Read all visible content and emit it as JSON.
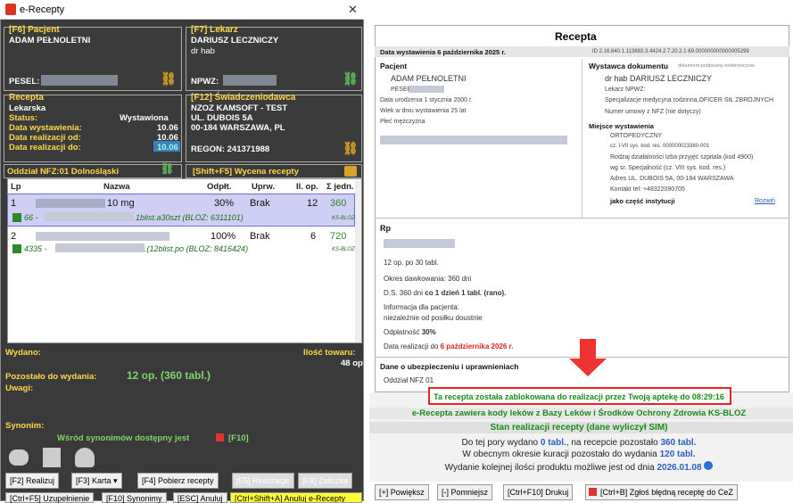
{
  "window": {
    "title": "e-Recepty",
    "close": "✕"
  },
  "patient": {
    "header": "[F6] Pacjent",
    "name": "ADAM PEŁNOLETNI",
    "pesel_label": "PESEL:"
  },
  "doctor": {
    "header": "[F7] Lekarz",
    "name": "DARIUSZ LECZNICZY",
    "title": "dr hab",
    "npwz_label": "NPWZ:"
  },
  "rx": {
    "header": "Recepta",
    "type": "Lekarska",
    "status_label": "Status:",
    "status_value": "Wystawiona",
    "issued_label": "Data wystawienia:",
    "issued_value": "10.06",
    "from_label": "Data realizacji od:",
    "from_value": "10.06",
    "to_label": "Data realizacji do:",
    "to_value": "10.06"
  },
  "provider": {
    "header": "[F12] Świadczeniodawca",
    "name": "NZOZ KAMSOFT - TEST",
    "street": "UL. DUBOIS 5A",
    "city": "00-184 WARSZAWA, PL",
    "regon": "REGON: 241371988"
  },
  "nfz": {
    "label": "Oddział NFZ:01 Dolnośląski",
    "valuation": "[Shift+F5] Wycena recepty"
  },
  "table": {
    "headers": [
      "Lp",
      "Nazwa",
      "Odpłt.",
      "Uprw.",
      "Il. op.",
      "Σ jedn."
    ],
    "rows": [
      {
        "lp": "1",
        "name_end": "10 mg",
        "pay": "30%",
        "perm": "Brak",
        "qty": "12",
        "units": "360",
        "code": "66 -",
        "pack": "1blist.a30szt (BLOZ: 6311101)",
        "tag": "KS-BLOZ"
      },
      {
        "lp": "2",
        "name_end": "",
        "pay": "100%",
        "perm": "Brak",
        "qty": "6",
        "units": "720",
        "code": "4335 -",
        "pack": ".(12blist.po (BLOZ: 8416424)",
        "tag": "KS-BLOZ"
      }
    ]
  },
  "dispense": {
    "issued_label": "Wydano:",
    "qty_label": "Ilość towaru:",
    "qty_value": "48 op",
    "remaining_label": "Pozostało do wydania:",
    "remaining_value": "12 op. (360 tabl.)",
    "notes_label": "Uwagi:",
    "synonym_label": "Synonim:",
    "synonym_text": "Wśród synonimów dostępny jest",
    "synonym_key": "[F10]"
  },
  "buttons": {
    "realize": "[F2] Realizuj",
    "card": "[F3] Karta ▾",
    "fetch": "[F4] Pobierz recepty",
    "f5": "[F5] Realizacje",
    "f8": "[F8] Zaliczka",
    "row2a": "[Ctrl+F5] Uzupełnienie",
    "row2b": "[F10] Synonimy",
    "row2c": "[ESC] Anuluj",
    "row2d": "[Ctrl+Shift+A] Anuluj e-Recepty"
  },
  "doc": {
    "title": "Recepta",
    "issued": "Data wystawienia 6 października 2025 r.",
    "id": "ID 2.16.840.1.113883.3.4424.2.7.20.2.1 69.000000000000005299",
    "patient_h": "Pacjent",
    "patient_name": "ADAM PEŁNOLETNI",
    "pesel": "PESEL",
    "dob": "Data urodzenia 1 stycznia 2000 r.",
    "age": "Wiek w dniu wystawienia 25 lat",
    "sex": "Płeć mężczyzna",
    "issuer_h": "Wystawca dokumentu",
    "issuer_note": "dokument podpisany elektronicznie",
    "issuer_name": "dr hab DARIUSZ LECZNICZY",
    "npwz": "Lekarz NPWZ:",
    "spec": "Specjalizacje medycyna rodzinna,OFICER SIŁ ZBROJNYCH",
    "contract": "Numer umowy z NFZ (nie dotyczy)",
    "place_h": "Miejsce wystawienia",
    "place1": "ORTOPEDYCZNY",
    "place2": "cz. I-VII sys. kod. res. 000000023380-001",
    "place3": "Rodzaj działalności Izba przyjęć szpitala (kod 4900)",
    "place4": "wg sr. Specjalność (cz. VIII sys. kod. res.)",
    "place5": "Adres UL. DUBOIS 5A, 00-184 WARSZAWA",
    "place6": "Kontakt tel: +48322090705",
    "place7": "jako część instytucji",
    "expand": "Rozwiń",
    "rp": "Rp",
    "l1": "12 op. po 30 tabl.",
    "l2": "Okres dawkowania: 360 dni",
    "l3a": "D.S. 360 dni ",
    "l3b": "co 1 dzień 1 tabl. (rano).",
    "l4": "Informacja dla pacjenta:",
    "l5": "niezależnie od posiłku doustnie",
    "l6a": "Odpłatność ",
    "l6b": "30%",
    "l7a": "Data realizacji do ",
    "l7b": "6 października 2026 r.",
    "ins_h": "Dane o ubezpieczeniu i uprawnieniach",
    "ins": "Oddział NFZ 01"
  },
  "status": {
    "blocked": "Ta recepta została zablokowana do realizacji przez Twoją aptekę do 08:29:16",
    "codes": "e-Recepta zawiera kody leków z Bazy Leków i Środków Ochrony Zdrowia KS-BLOZ",
    "state": "Stan realizacji recepty (dane wyliczył SIM)",
    "s1a": "Do tej pory wydano ",
    "s1b": "0 tabl.",
    "s1c": ", na recepcie pozostało ",
    "s1d": "360 tabl.",
    "s2a": "W obecnym okresie kuracji pozostało do wydania ",
    "s2b": "120 tabl.",
    "s3a": "Wydanie kolejnej ilości produktu możliwe jest od dnia ",
    "s3b": "2026.01.08"
  },
  "bottom": {
    "zoom_in": "[+] Powiększ",
    "zoom_out": "[-] Pomniejsz",
    "print": "[Ctrl+F10] Drukuj",
    "report": "[Ctrl+B] Zgłoś błędną receptę do CeZ"
  }
}
